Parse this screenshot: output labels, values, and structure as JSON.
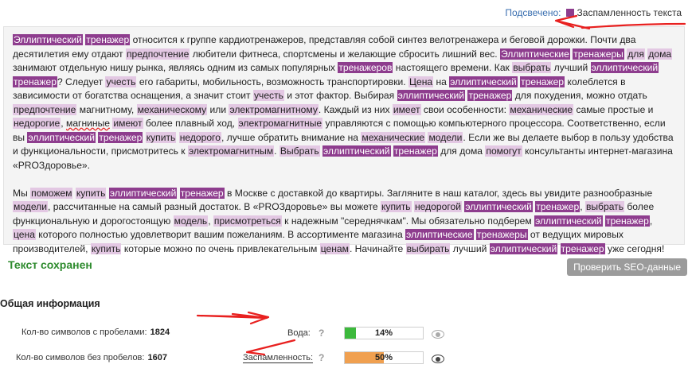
{
  "legend": {
    "label": "Подсвечено:",
    "item": "Заспамленность текста",
    "color": "#8e3d8e"
  },
  "text_paragraphs": [
    [
      {
        "t": "Эллиптический",
        "h": 2
      },
      " ",
      {
        "t": "тренажер",
        "h": 2
      },
      " относится к группе кардиотренажеров, представляя собой синтез велотренажера и беговой дорожки. Почти два десятилетия ему отдают ",
      {
        "t": "предпочтение",
        "h": 1
      },
      " любители фитнеса, спортсмены и желающие сбросить лишний вес. ",
      {
        "t": "Эллиптические",
        "h": 2
      },
      " ",
      {
        "t": "тренажеры",
        "h": 2
      },
      " ",
      {
        "t": "для",
        "h": 1
      },
      " ",
      {
        "t": "дома",
        "h": 1
      },
      " занимают отдельную нишу рынка, являясь одним из самых популярных ",
      {
        "t": "тренажеров",
        "h": 2
      },
      " настоящего времени. Как ",
      {
        "t": "выбрать",
        "h": 1
      },
      " лучший ",
      {
        "t": "эллиптический",
        "h": 2
      },
      " ",
      {
        "t": "тренажер",
        "h": 2
      },
      "? Следует ",
      {
        "t": "учесть",
        "h": 1
      },
      " его габариты, мобильность, возможность транспортировки. ",
      {
        "t": "Цена",
        "h": 1
      },
      " на ",
      {
        "t": "эллиптический",
        "h": 2
      },
      " ",
      {
        "t": "тренажер",
        "h": 2
      },
      " колеблется в зависимости от богатства оснащения, а значит стоит ",
      {
        "t": "учесть",
        "h": 1
      },
      " и этот фактор. Выбирая ",
      {
        "t": "эллиптический",
        "h": 2
      },
      " ",
      {
        "t": "тренажер",
        "h": 2
      },
      " для похудения, можно отдать ",
      {
        "t": "предпочтение",
        "h": 1
      },
      " магнитному, ",
      {
        "t": "механическому",
        "h": 1
      },
      " или ",
      {
        "t": "электромагнитному",
        "h": 1
      },
      ". Каждый из них ",
      {
        "t": "имеет",
        "h": 1
      },
      " свои особенности: ",
      {
        "t": "механические",
        "h": 1
      },
      " самые простые и ",
      {
        "t": "недорогие",
        "h": 1
      },
      ", ",
      {
        "t": "магниные",
        "h": 0,
        "u": 1
      },
      " ",
      {
        "t": "имеют",
        "h": 1
      },
      " более плавный ход, ",
      {
        "t": "электромагнитные",
        "h": 1
      },
      " управляются с помощью компьютерного процессора. Соответственно, если вы ",
      {
        "t": "эллиптический",
        "h": 2
      },
      " ",
      {
        "t": "тренажер",
        "h": 2
      },
      " ",
      {
        "t": "купить",
        "h": 1
      },
      " ",
      {
        "t": "недорого",
        "h": 1
      },
      ", лучше обратить внимание на ",
      {
        "t": "механические",
        "h": 1
      },
      " ",
      {
        "t": "модели",
        "h": 1
      },
      ". Если же вы делаете выбор в пользу удобства и функциональности, присмотритесь к ",
      {
        "t": "электромагнитным",
        "h": 1
      },
      ". ",
      {
        "t": "Выбрать",
        "h": 1
      },
      " ",
      {
        "t": "эллиптический",
        "h": 2
      },
      " ",
      {
        "t": "тренажер",
        "h": 2
      },
      " для дома ",
      {
        "t": "помогут",
        "h": 1
      },
      " консультанты интернет-магазина «PROЗдоровье»."
    ],
    [
      "Мы ",
      {
        "t": "поможем",
        "h": 1
      },
      " ",
      {
        "t": "купить",
        "h": 1
      },
      " ",
      {
        "t": "эллиптический",
        "h": 2
      },
      " ",
      {
        "t": "тренажер",
        "h": 2
      },
      " в Москве с доставкой до квартиры. Загляните в наш каталог, здесь вы увидите разнообразные ",
      {
        "t": "модели",
        "h": 1
      },
      ", рассчитанные на самый разный достаток. В «PROЗдоровье» вы можете ",
      {
        "t": "купить",
        "h": 1
      },
      " ",
      {
        "t": "недорогой",
        "h": 1
      },
      " ",
      {
        "t": "эллиптический",
        "h": 2
      },
      " ",
      {
        "t": "тренажер",
        "h": 2
      },
      ", ",
      {
        "t": "выбрать",
        "h": 1
      },
      " более функциональную и дорогостоящую ",
      {
        "t": "модель",
        "h": 1
      },
      ", ",
      {
        "t": "присмотреться",
        "h": 1
      },
      " к надежным \"середнячкам\". Мы обязательно подберем ",
      {
        "t": "эллиптический",
        "h": 2
      },
      " ",
      {
        "t": "тренажер",
        "h": 2
      },
      ", ",
      {
        "t": "цена",
        "h": 1
      },
      " которого полностью удовлетворит вашим пожеланиям. В ассортименте магазина ",
      {
        "t": "эллиптические",
        "h": 2
      },
      " ",
      {
        "t": "тренажеры",
        "h": 2
      },
      " от ведущих мировых производителей, ",
      {
        "t": "купить",
        "h": 1
      },
      " которые можно по очень привлекательным ",
      {
        "t": "ценам",
        "h": 1
      },
      ". Начинайте ",
      {
        "t": "выбирать",
        "h": 1
      },
      " лучший ",
      {
        "t": "эллиптический",
        "h": 2
      },
      " ",
      {
        "t": "тренажер",
        "h": 2
      },
      " уже сегодня!"
    ]
  ],
  "status": {
    "saved": "Текст сохранен"
  },
  "buttons": {
    "check_seo": "Проверить SEO-данные"
  },
  "general": {
    "title": "Общая информация",
    "chars_with_spaces_label": "Кол-во символов с пробелами:",
    "chars_with_spaces_value": "1824",
    "chars_without_spaces_label": "Кол-во символов без пробелов:",
    "chars_without_spaces_value": "1607"
  },
  "metrics": {
    "water": {
      "label": "Вода:",
      "value": "14%",
      "percent": 14,
      "color": "#3cb93c"
    },
    "spam": {
      "label": "Заспамленность:",
      "value": "50%",
      "percent": 50,
      "color": "#f0a050"
    },
    "help": "?"
  },
  "icons": {
    "legend": "legend-swatch",
    "water_eye": "eye-icon",
    "spam_eye": "eye-icon",
    "help": "question-icon"
  },
  "annotation_color": "#e8201f"
}
